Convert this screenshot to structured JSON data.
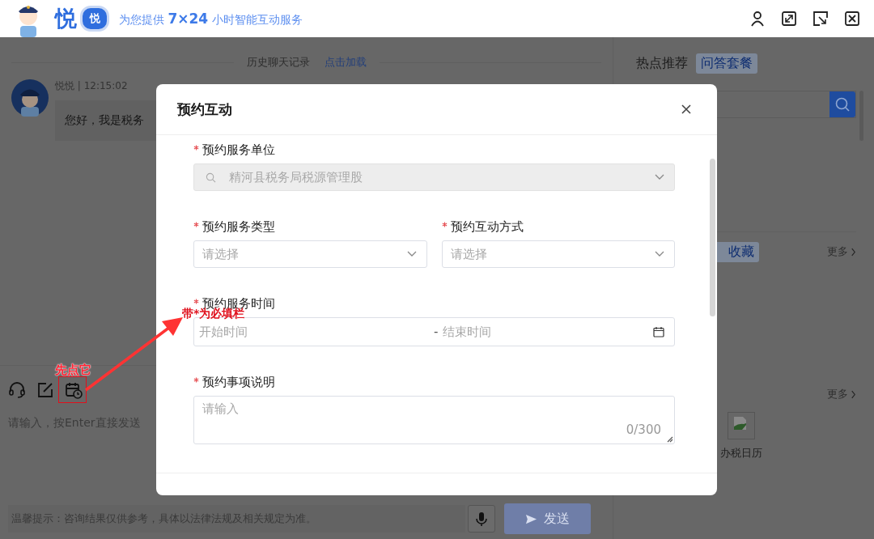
{
  "header": {
    "brand": "悦",
    "badge": "悦",
    "slogan": "为您提供 **7×24** 小时智能互动服务"
  },
  "chat": {
    "history_label": "历史聊天记录",
    "history_link": "点击加载",
    "messages": [
      {
        "meta": "悦悦 | 12:15:02",
        "text": "您好，我是税务"
      }
    ],
    "composer": {
      "placeholder": "请输入，按Enter直接发送",
      "tip": "温馨提示：咨询结果仅供参考，具体以法律法规及相关规定为准。",
      "send_label": "发送"
    }
  },
  "sidebar": {
    "tabs": [
      {
        "label": "热点推荐",
        "selected": false
      },
      {
        "label": "问答套餐",
        "selected": true
      }
    ],
    "sections": [
      {
        "tab": {
          "label": "收藏",
          "selected": true
        },
        "more": "更多"
      },
      {
        "more": "更多",
        "links": [
          {
            "label": "办税日历"
          }
        ]
      }
    ]
  },
  "dialog": {
    "title": "预约互动",
    "rows": [
      [
        {
          "kind": "select",
          "label": "预约服务单位",
          "required": true,
          "value": "精河县税务局税源管理股",
          "disabled": true,
          "searchable": true
        }
      ],
      [
        {
          "kind": "select",
          "label": "预约服务类型",
          "required": true,
          "placeholder": "请选择",
          "disabled": false
        },
        {
          "kind": "select",
          "label": "预约互动方式",
          "required": true,
          "placeholder": "请选择",
          "disabled": false
        }
      ],
      [
        {
          "kind": "daterange",
          "label": "预约服务时间",
          "required": true,
          "start_placeholder": "开始时间",
          "separator": "-",
          "end_placeholder": "结束时间"
        }
      ],
      [
        {
          "kind": "textarea",
          "label": "预约事项说明",
          "required": true,
          "placeholder": "请输入",
          "counter": "0/300"
        }
      ]
    ]
  },
  "annotations": {
    "step_hint": "先点它",
    "required_hint": "带*为必填栏"
  }
}
